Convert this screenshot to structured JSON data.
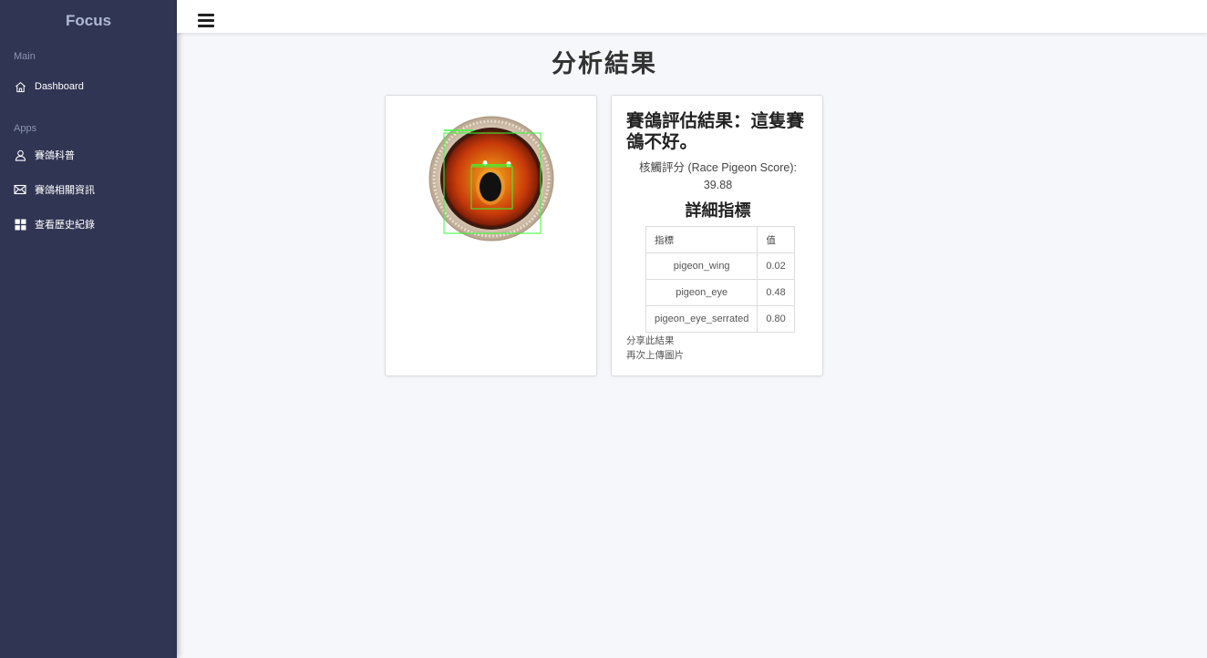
{
  "sidebar": {
    "brand": "Focus",
    "sections": {
      "main": "Main",
      "apps": "Apps"
    },
    "items": [
      {
        "label": "Dashboard",
        "icon": "home-icon"
      },
      {
        "label": "賽鴿科普",
        "icon": "user-icon"
      },
      {
        "label": "賽鴿相關資訊",
        "icon": "mail-icon"
      },
      {
        "label": "查看歷史紀錄",
        "icon": "grid-icon"
      }
    ]
  },
  "topbar": {
    "menu_icon": "hamburger-icon"
  },
  "page": {
    "title": "分析結果"
  },
  "image_card": {
    "image": "pigeon-eye-detection-image"
  },
  "result": {
    "title": "賽鴿評估結果：這隻賽鴿不好。",
    "score_label": "核觸評分 (Race Pigeon Score):",
    "score_value": "39.88",
    "detail_title": "詳細指標",
    "table": {
      "headers": [
        "指標",
        "值"
      ],
      "rows": [
        {
          "name": "pigeon_wing",
          "value": "0.02"
        },
        {
          "name": "pigeon_eye",
          "value": "0.48"
        },
        {
          "name": "pigeon_eye_serrated",
          "value": "0.80"
        }
      ]
    },
    "links": {
      "share": "分享此結果",
      "reupload": "再次上傳圖片"
    }
  },
  "colors": {
    "sidebar_bg": "#303553",
    "page_bg": "#f6f7fa",
    "detection_box": "#33ff33"
  }
}
